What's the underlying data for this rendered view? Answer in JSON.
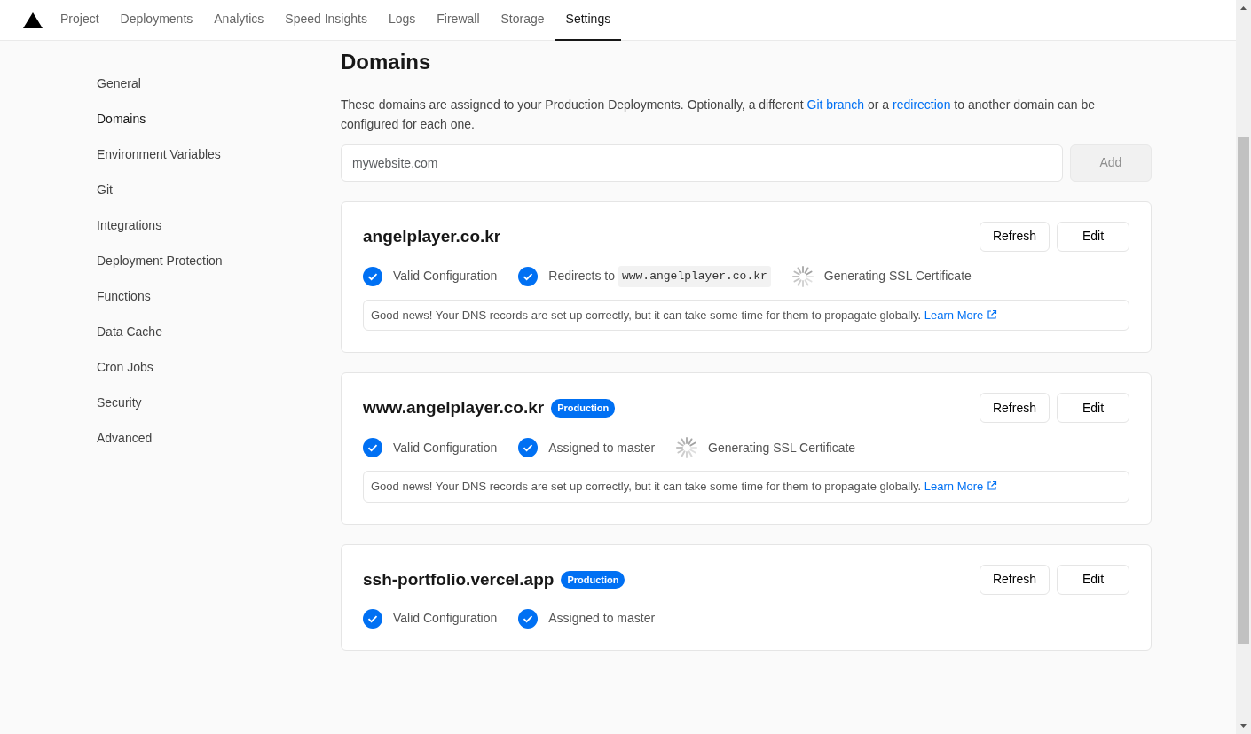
{
  "nav": {
    "tabs": [
      {
        "label": "Project",
        "selected": false
      },
      {
        "label": "Deployments",
        "selected": false
      },
      {
        "label": "Analytics",
        "selected": false
      },
      {
        "label": "Speed Insights",
        "selected": false
      },
      {
        "label": "Logs",
        "selected": false
      },
      {
        "label": "Firewall",
        "selected": false
      },
      {
        "label": "Storage",
        "selected": false
      },
      {
        "label": "Settings",
        "selected": true
      }
    ]
  },
  "sidebar": {
    "items": [
      {
        "label": "General",
        "selected": false
      },
      {
        "label": "Domains",
        "selected": true
      },
      {
        "label": "Environment Variables",
        "selected": false
      },
      {
        "label": "Git",
        "selected": false
      },
      {
        "label": "Integrations",
        "selected": false
      },
      {
        "label": "Deployment Protection",
        "selected": false
      },
      {
        "label": "Functions",
        "selected": false
      },
      {
        "label": "Data Cache",
        "selected": false
      },
      {
        "label": "Cron Jobs",
        "selected": false
      },
      {
        "label": "Security",
        "selected": false
      },
      {
        "label": "Advanced",
        "selected": false
      }
    ]
  },
  "title": "Domains",
  "description": [
    {
      "kind": "text",
      "text": "These domains are assigned to your Production Deployments. Optionally, a different "
    },
    {
      "kind": "link",
      "text": "Git branch"
    },
    {
      "kind": "text",
      "text": " or a "
    },
    {
      "kind": "link",
      "text": "redirection"
    },
    {
      "kind": "text",
      "text": " to another domain can be configured for each one."
    }
  ],
  "add_form": {
    "placeholder": "mywebsite.com",
    "button": "Add",
    "disabled": true
  },
  "domains": [
    {
      "name": "angelplayer.co.kr",
      "buttons": [
        "Refresh",
        "Edit"
      ],
      "status": [
        {
          "kind": "check",
          "text": "Valid Configuration"
        },
        {
          "kind": "check",
          "text": "Redirects to",
          "code": "www.angelplayer.co.kr"
        },
        {
          "kind": "spinner",
          "text": "Generating SSL Certificate"
        }
      ],
      "notice": {
        "text": "Good news! Your DNS records are set up correctly, but it can take some time for them to propagate globally.",
        "link": "Learn More"
      }
    },
    {
      "name": "www.angelplayer.co.kr",
      "badge": "Production",
      "buttons": [
        "Refresh",
        "Edit"
      ],
      "status": [
        {
          "kind": "check",
          "text": "Valid Configuration"
        },
        {
          "kind": "check",
          "text": "Assigned to master"
        },
        {
          "kind": "spinner",
          "text": "Generating SSL Certificate"
        }
      ],
      "notice": {
        "text": "Good news! Your DNS records are set up correctly, but it can take some time for them to propagate globally.",
        "link": "Learn More"
      }
    },
    {
      "name": "ssh-portfolio.vercel.app",
      "badge": "Production",
      "buttons": [
        "Refresh",
        "Edit"
      ],
      "status": [
        {
          "kind": "check",
          "text": "Valid Configuration"
        },
        {
          "kind": "check",
          "text": "Assigned to master"
        }
      ]
    }
  ]
}
